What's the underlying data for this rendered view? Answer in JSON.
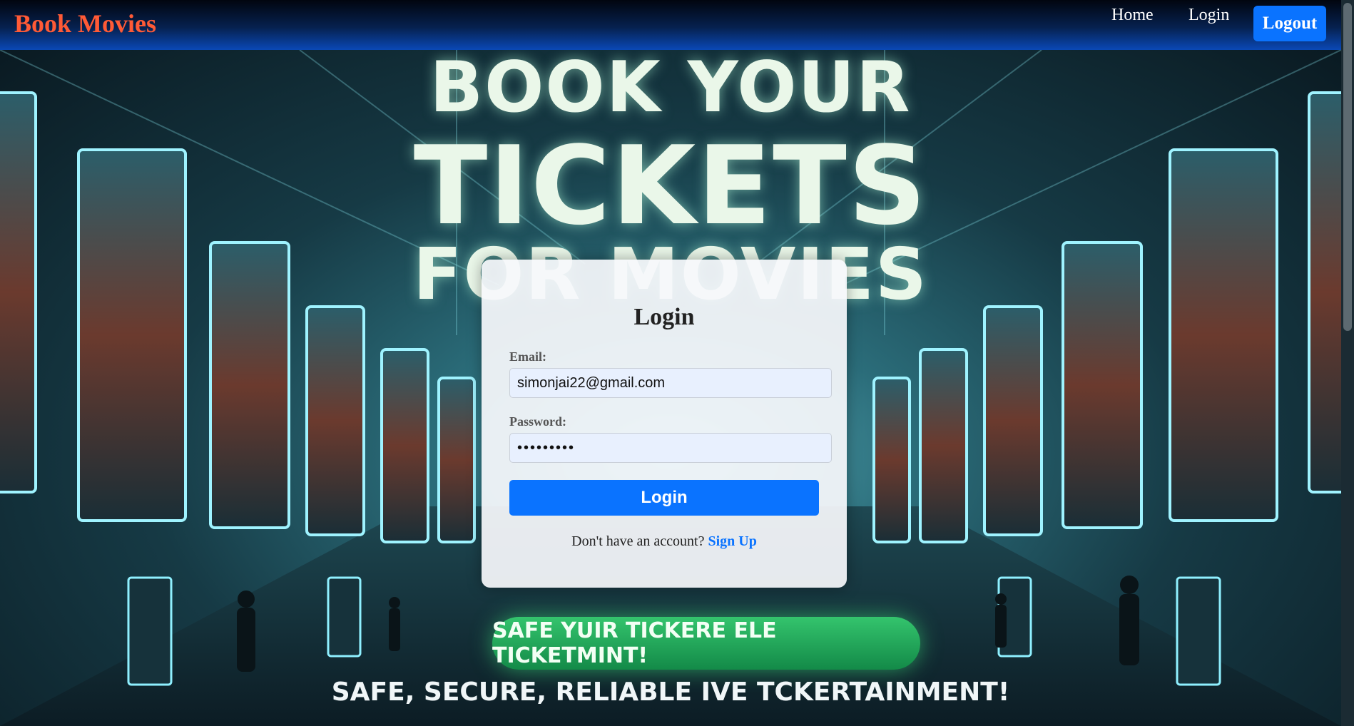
{
  "navbar": {
    "brand": "Book Movies",
    "links": [
      {
        "label": "Home"
      },
      {
        "label": "Login"
      }
    ],
    "logout_label": "Logout"
  },
  "hero": {
    "headline_line1": "BOOK YOUR",
    "headline_line2": "TICKETS",
    "headline_line3": "FOR MOVIES",
    "banner_text": "SAFE YUIR TICKERE  ELE TICKETMINT!",
    "tagline": "SAFE, SECURE, RELIABLE IVE TCKERTAINMENT!"
  },
  "login_form": {
    "title": "Login",
    "email_label": "Email:",
    "email_value": "simonjai22@gmail.com",
    "password_label": "Password:",
    "password_value": "•••••••••",
    "submit_label": "Login",
    "signup_prompt": "Don't have an account?",
    "signup_link": "Sign Up"
  },
  "colors": {
    "brand": "#ff5a36",
    "accent": "#0a73ff",
    "navbar_bottom": "#0a48b6"
  }
}
